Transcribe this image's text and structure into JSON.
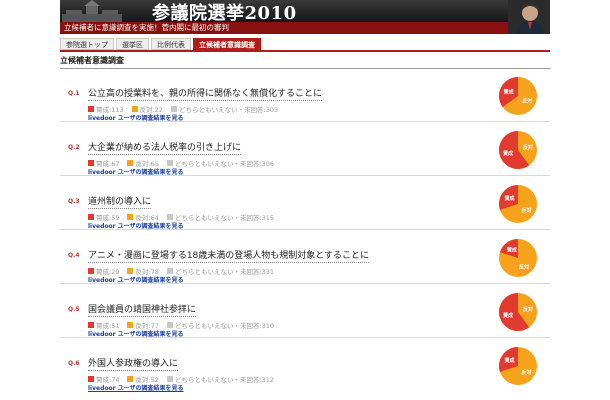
{
  "header": {
    "title": "参議院選挙2010",
    "subtitle": "立候補者に意識調査を実施！菅内閣に最初の審判"
  },
  "nav": {
    "tabs": [
      {
        "label": "参院選トップ",
        "active": false
      },
      {
        "label": "選挙区",
        "active": false
      },
      {
        "label": "比例代表",
        "active": false
      },
      {
        "label": "立候補者意識調査",
        "active": true
      }
    ]
  },
  "section_title": "立候補者意識調査",
  "legend": {
    "yes_label": "賛成",
    "no_label": "反対",
    "neutral_label": "どちらともいえない・未回答"
  },
  "link_label": "livedoor ユーザの調査結果を見る",
  "colors": {
    "yes": "#e23a2e",
    "no": "#f7a21b",
    "neutral": "#c8c8c8",
    "accent": "#b31b1b"
  },
  "questions": [
    {
      "num": "Q.1",
      "text": "公立高の授業料を、親の所得に関係なく無償化することに",
      "yes": 113,
      "no": 22,
      "neutral": 303,
      "yes_text": "賛成:113",
      "no_text": "反対:22",
      "neutral_text": "どちらともいえない・未回答:303"
    },
    {
      "num": "Q.2",
      "text": "大企業が納める法人税率の引き上げに",
      "yes": 67,
      "no": 65,
      "neutral": 306,
      "yes_text": "賛成:67",
      "no_text": "反対:65",
      "neutral_text": "どちらともいえない・未回答:306"
    },
    {
      "num": "Q.3",
      "text": "道州制の導入に",
      "yes": 59,
      "no": 64,
      "neutral": 315,
      "yes_text": "賛成:59",
      "no_text": "反対:64",
      "neutral_text": "どちらともいえない・未回答:315"
    },
    {
      "num": "Q.4",
      "text": "アニメ・漫画に登場する18歳未満の登場人物も規制対象とすることに",
      "yes": 29,
      "no": 78,
      "neutral": 331,
      "yes_text": "賛成:29",
      "no_text": "反対:78",
      "neutral_text": "どちらともいえない・未回答:331"
    },
    {
      "num": "Q.5",
      "text": "国会議員の靖国神社参拝に",
      "yes": 51,
      "no": 77,
      "neutral": 310,
      "yes_text": "賛成:51",
      "no_text": "反対:77",
      "neutral_text": "どちらともいえない・未回答:310"
    },
    {
      "num": "Q.6",
      "text": "外国人参政権の導入に",
      "yes": 74,
      "no": 52,
      "neutral": 312,
      "yes_text": "賛成:74",
      "no_text": "反対:52",
      "neutral_text": "どちらともいえない・未回答:312"
    }
  ],
  "livedoor_user_results": [
    {
      "yes_share": 0.35,
      "no_share": 0.65
    },
    {
      "yes_share": 0.6,
      "no_share": 0.4
    },
    {
      "yes_share": 0.3,
      "no_share": 0.7
    },
    {
      "yes_share": 0.2,
      "no_share": 0.8
    },
    {
      "yes_share": 0.6,
      "no_share": 0.4
    },
    {
      "yes_share": 0.3,
      "no_share": 0.7
    }
  ]
}
